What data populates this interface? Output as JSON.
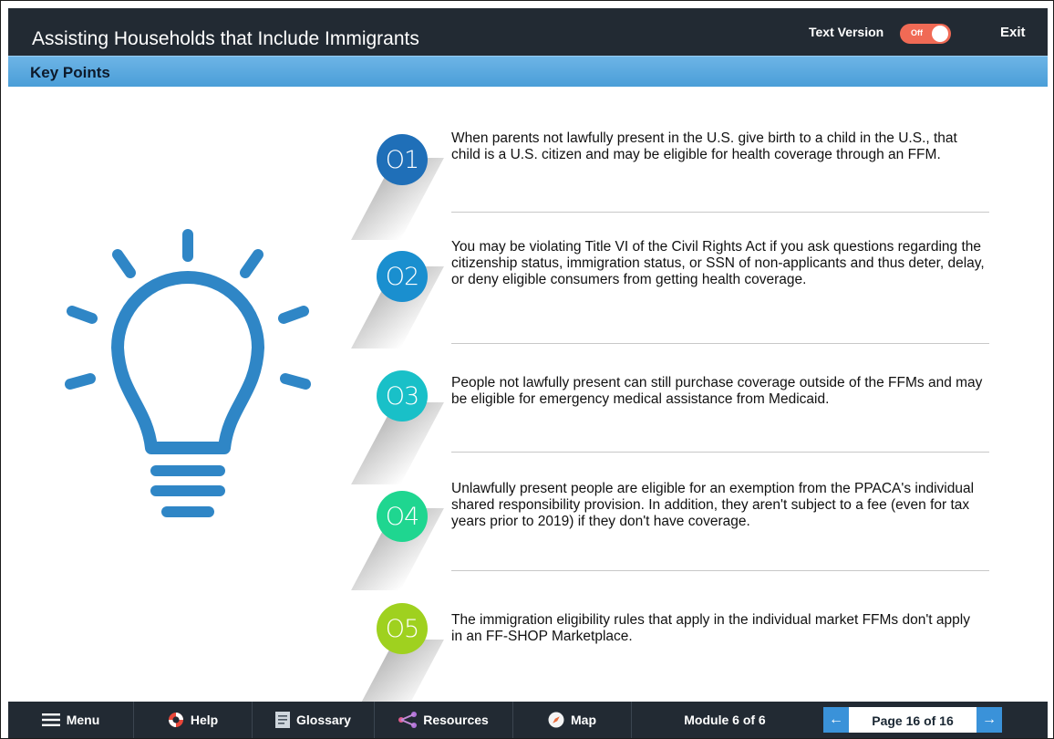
{
  "header": {
    "title": "Assisting Households that Include Immigrants",
    "text_version_label": "Text Version",
    "toggle_state": "Off",
    "exit_label": "Exit"
  },
  "subheader": {
    "title": "Key Points"
  },
  "points": [
    {
      "number": "O1",
      "color": "#1f6fb8",
      "text": "When parents not lawfully present in the U.S. give birth to a child in the U.S., that child is a U.S. citizen and may be eligible for health coverage through an FFM."
    },
    {
      "number": "O2",
      "color": "#1a8fcf",
      "text": "You may be violating Title VI of the Civil Rights Act if you ask questions regarding the citizenship status, immigration status, or SSN of non-applicants and thus deter, delay, or deny eligible consumers from getting health coverage."
    },
    {
      "number": "O3",
      "color": "#19c0c8",
      "text": "People not lawfully present can still purchase coverage outside of the FFMs and may be eligible for emergency medical assistance from Medicaid."
    },
    {
      "number": "O4",
      "color": "#1fd690",
      "text": "Unlawfully present people are eligible for an exemption from the PPACA's individual shared responsibility provision. In addition, they aren't subject to a fee (even for tax years prior to 2019) if they don't have coverage."
    },
    {
      "number": "O5",
      "color": "#9fd11f",
      "text": "The immigration eligibility rules that apply in the individual market FFMs don't apply in an FF-SHOP Marketplace."
    }
  ],
  "nav": {
    "menu": "Menu",
    "help": "Help",
    "glossary": "Glossary",
    "resources": "Resources",
    "map": "Map",
    "module": "Module 6 of 6",
    "page": "Page 16 of 16"
  },
  "colors": {
    "bar": "#222a33",
    "accent": "#3a92d9",
    "bulb": "#2f86c6",
    "toggle": "#f06a55"
  }
}
